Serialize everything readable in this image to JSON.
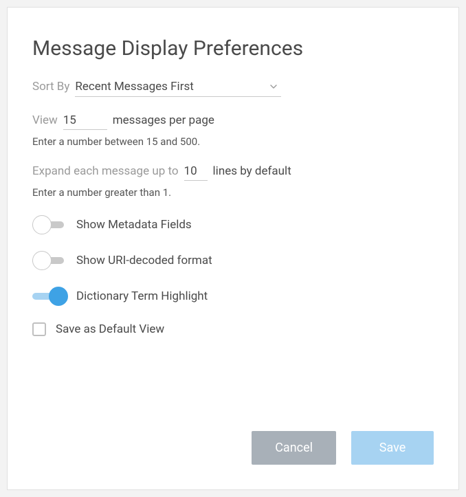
{
  "title": "Message Display Preferences",
  "sortBy": {
    "label": "Sort By",
    "value": "Recent Messages First"
  },
  "view": {
    "label": "View",
    "value": "15",
    "suffix": "messages per page",
    "hint": "Enter a number between 15 and 500."
  },
  "expand": {
    "prefix": "Expand each message up to",
    "value": "10",
    "suffix": "lines by default",
    "hint": "Enter a number greater than 1."
  },
  "toggles": {
    "metadata": {
      "label": "Show Metadata Fields",
      "on": false
    },
    "uri": {
      "label": "Show URI-decoded format",
      "on": false
    },
    "dictionary": {
      "label": "Dictionary Term Highlight",
      "on": true
    }
  },
  "saveDefault": {
    "label": "Save as Default View",
    "checked": false
  },
  "buttons": {
    "cancel": "Cancel",
    "save": "Save"
  }
}
